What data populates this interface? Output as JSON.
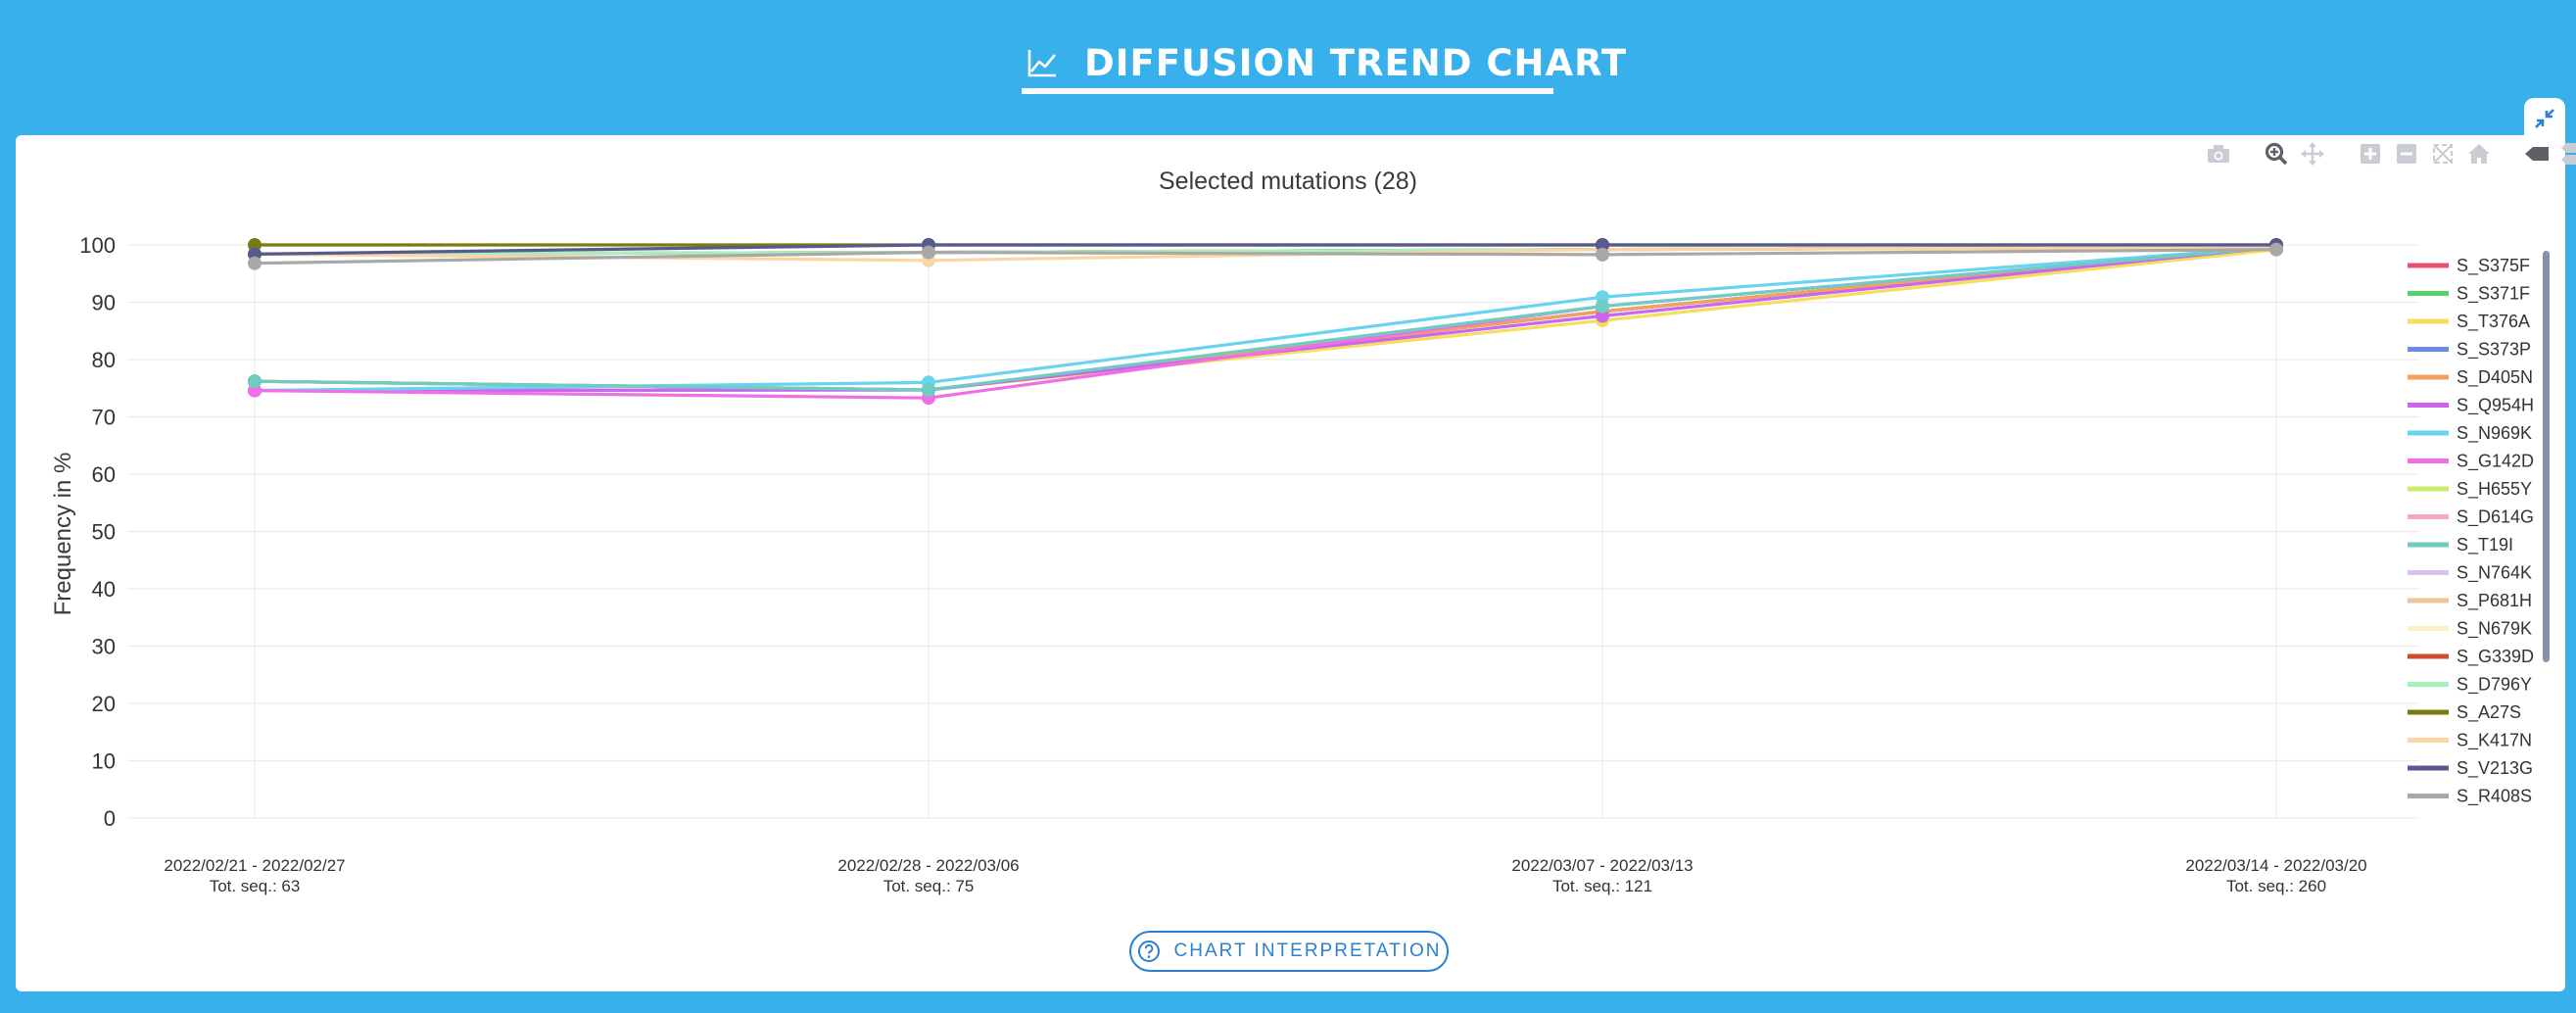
{
  "header": {
    "title": "DIFFUSION TREND CHART",
    "icon": "line-chart-icon"
  },
  "toolbar": {
    "collapse_icon": "collapse-arrows-icon",
    "modebar_icons": [
      "camera-icon",
      "zoom-icon",
      "pan-icon",
      "zoom-in-icon",
      "zoom-out-icon",
      "autoscale-icon",
      "reset-axes-icon",
      "spike-lines-icon",
      "compare-hover-icon"
    ]
  },
  "footer": {
    "interpretation_button": "CHART INTERPRETATION",
    "interpretation_icon": "help-circle-icon"
  },
  "chart_data": {
    "type": "line",
    "title": "Selected mutations (28)",
    "ylabel": "Frequency in %",
    "xlabel": "",
    "ylim": [
      0,
      100
    ],
    "yticks": [
      "0",
      "10",
      "20",
      "30",
      "40",
      "50",
      "60",
      "70",
      "80",
      "90",
      "100"
    ],
    "grid": true,
    "legend_position": "right",
    "categories": [
      {
        "range": "2022/02/21 - 2022/02/27",
        "total": "Tot. seq.: 63"
      },
      {
        "range": "2022/02/28 - 2022/03/06",
        "total": "Tot. seq.: 75"
      },
      {
        "range": "2022/03/07 - 2022/03/13",
        "total": "Tot. seq.: 121"
      },
      {
        "range": "2022/03/14 - 2022/03/20",
        "total": "Tot. seq.: 260"
      }
    ],
    "series": [
      {
        "name": "S_S375F",
        "color": "#e8506e",
        "values": [
          76.2,
          74.7,
          88.4,
          99.6
        ]
      },
      {
        "name": "S_S371F",
        "color": "#55d26a",
        "values": [
          76.2,
          74.7,
          88.4,
          99.6
        ]
      },
      {
        "name": "S_T376A",
        "color": "#f3df5c",
        "values": [
          76.2,
          74.7,
          86.8,
          99.2
        ]
      },
      {
        "name": "S_S373P",
        "color": "#6b8ae6",
        "values": [
          74.6,
          74.7,
          88.4,
          99.6
        ]
      },
      {
        "name": "S_D405N",
        "color": "#f4a15f",
        "values": [
          76.2,
          74.7,
          88.4,
          99.6
        ]
      },
      {
        "name": "S_Q954H",
        "color": "#cc66ee",
        "values": [
          74.6,
          74.7,
          87.6,
          99.6
        ]
      },
      {
        "name": "S_N969K",
        "color": "#6ad3ee",
        "values": [
          74.6,
          76.0,
          90.9,
          99.6
        ]
      },
      {
        "name": "S_G142D",
        "color": "#ee70e4",
        "values": [
          74.6,
          73.3,
          89.3,
          99.6
        ]
      },
      {
        "name": "S_H655Y",
        "color": "#c5ee6e",
        "values": [
          98.4,
          98.7,
          99.2,
          99.6
        ]
      },
      {
        "name": "S_D614G",
        "color": "#f4a8c8",
        "values": [
          98.4,
          98.7,
          99.2,
          99.6
        ]
      },
      {
        "name": "S_T19I",
        "color": "#6ecdc2",
        "values": [
          76.2,
          74.7,
          89.3,
          99.6
        ]
      },
      {
        "name": "S_N764K",
        "color": "#dcc0f0",
        "values": [
          98.4,
          98.7,
          99.2,
          99.6
        ]
      },
      {
        "name": "S_P681H",
        "color": "#efc397",
        "values": [
          98.4,
          98.7,
          99.2,
          99.6
        ]
      },
      {
        "name": "S_N679K",
        "color": "#fdeec7",
        "values": [
          98.4,
          98.7,
          99.2,
          99.6
        ]
      },
      {
        "name": "S_G339D",
        "color": "#d24a30",
        "values": [
          98.4,
          98.7,
          99.2,
          99.6
        ]
      },
      {
        "name": "S_D796Y",
        "color": "#a6f0c0",
        "values": [
          98.4,
          98.7,
          99.2,
          99.6
        ]
      },
      {
        "name": "S_A27S",
        "color": "#7a7a10",
        "values": [
          100,
          100,
          100,
          100
        ]
      },
      {
        "name": "S_K417N",
        "color": "#fad6a6",
        "values": [
          98.4,
          97.3,
          99.2,
          99.6
        ]
      },
      {
        "name": "S_V213G",
        "color": "#575a8c",
        "values": [
          98.4,
          100,
          100,
          100
        ]
      },
      {
        "name": "S_R408S",
        "color": "#a8a8a8",
        "values": [
          96.8,
          98.7,
          98.3,
          99.2
        ]
      }
    ]
  }
}
